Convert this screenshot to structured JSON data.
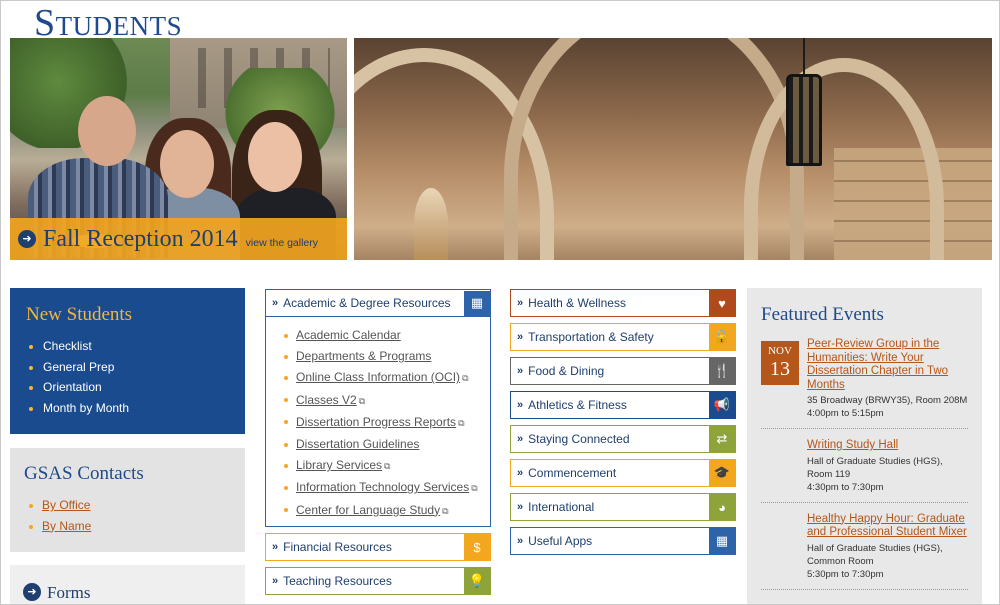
{
  "page": {
    "title": "Students"
  },
  "hero": {
    "reception_title": "Fall Reception 2014",
    "reception_link": "view the gallery"
  },
  "new_students": {
    "title": "New Students",
    "items": [
      "Checklist",
      "General Prep",
      "Orientation",
      "Month by Month"
    ]
  },
  "contacts": {
    "title": "GSAS Contacts",
    "items": [
      "By Office",
      "By Name"
    ]
  },
  "forms": {
    "title": "Forms"
  },
  "academic": {
    "title": "Academic & Degree Resources",
    "icon": "grid-icon",
    "items": [
      {
        "label": "Academic Calendar",
        "external": false
      },
      {
        "label": "Departments & Programs",
        "external": false
      },
      {
        "label": "Online Class Information (OCI)",
        "external": true
      },
      {
        "label": "Classes V2",
        "external": true
      },
      {
        "label": "Dissertation Progress Reports",
        "external": true
      },
      {
        "label": "Dissertation Guidelines",
        "external": false
      },
      {
        "label": "Library Services",
        "external": true
      },
      {
        "label": "Information Technology Services",
        "external": true
      },
      {
        "label": "Center for Language Study",
        "external": true
      }
    ]
  },
  "middle_buttons": [
    {
      "label": "Financial Resources",
      "icon": "dollar-icon",
      "glyph": "$",
      "color": "#f2a71e"
    },
    {
      "label": "Teaching Resources",
      "icon": "lightbulb-icon",
      "glyph": "💡",
      "color": "#8ea33a"
    }
  ],
  "right_buttons": [
    {
      "label": "Health & Wellness",
      "icon": "heart-icon",
      "glyph": "♥",
      "color": "#b04a1c"
    },
    {
      "label": "Transportation & Safety",
      "icon": "lock-icon",
      "glyph": "🔓",
      "color": "#f2a71e"
    },
    {
      "label": "Food & Dining",
      "icon": "utensils-icon",
      "glyph": "🍴",
      "color": "#666666"
    },
    {
      "label": "Athletics & Fitness",
      "icon": "megaphone-icon",
      "glyph": "📢",
      "color": "#1a4b8e"
    },
    {
      "label": "Staying Connected",
      "icon": "exchange-icon",
      "glyph": "⇄",
      "color": "#8ea33a"
    },
    {
      "label": "Commencement",
      "icon": "graduation-cap-icon",
      "glyph": "🎓",
      "color": "#f2a71e"
    },
    {
      "label": "International",
      "icon": "globe-icon",
      "glyph": "◕",
      "color": "#8ea33a"
    },
    {
      "label": "Useful Apps",
      "icon": "grid-icon",
      "glyph": "▦",
      "color": "#2d63a8"
    }
  ],
  "featured": {
    "title": "Featured Events",
    "date_month": "NOV",
    "date_day": "13",
    "events": [
      {
        "title": "Peer-Review Group in the Humanities: Write Your Dissertation Chapter in Two Months",
        "location": "35 Broadway (BRWY35), Room 208M",
        "time": "4:00pm to 5:15pm"
      },
      {
        "title": "Writing Study Hall",
        "location": "Hall of Graduate Studies (HGS), Room 119",
        "time": "4:30pm to 7:30pm"
      },
      {
        "title": "Healthy Happy Hour: Graduate and Professional Student Mixer",
        "location": "Hall of Graduate Studies (HGS), Common Room",
        "time": "5:30pm to 7:30pm"
      }
    ]
  }
}
